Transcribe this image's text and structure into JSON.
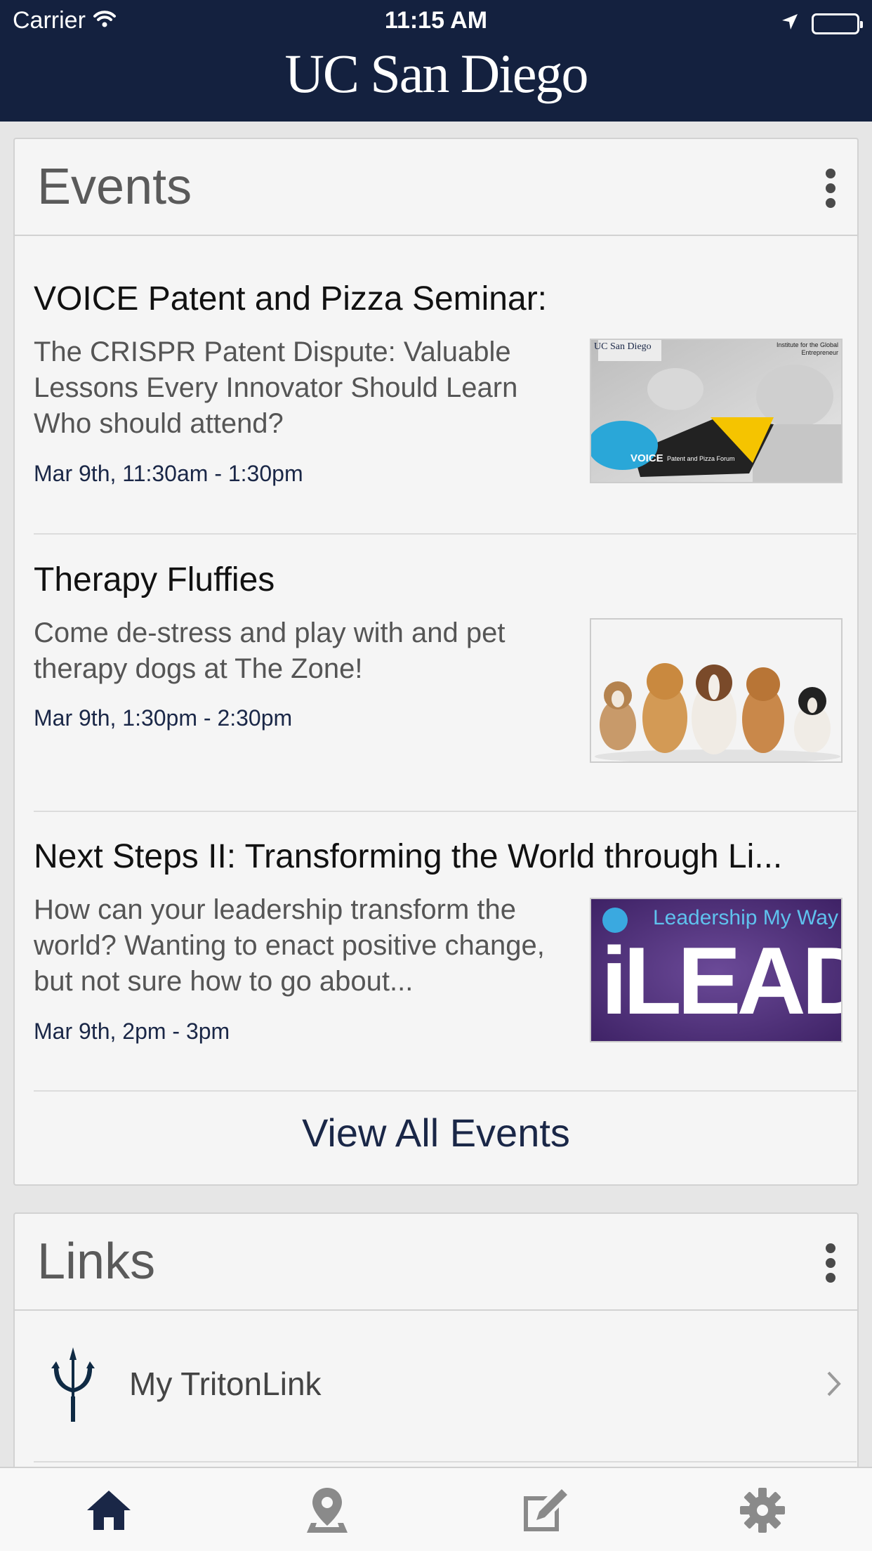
{
  "status_bar": {
    "carrier": "Carrier",
    "time": "11:15 AM"
  },
  "header": {
    "brand": "UC San Diego"
  },
  "events_card": {
    "title": "Events",
    "items": [
      {
        "title": "VOICE Patent and Pizza Seminar:",
        "description": "The CRISPR Patent Dispute: Valuable Lessons Every Innovator Should Learn Who should attend?",
        "date": "Mar 9th, 11:30am - 1:30pm",
        "thumbnail": {
          "brand_text": "UC San Diego",
          "corner_text": "Institute for the Global Entrepreneur",
          "banner_title": "VOICE",
          "banner_subtitle": "Patent and Pizza Forum"
        }
      },
      {
        "title": "Therapy Fluffies",
        "description": "Come de-stress and play with and pet therapy dogs at The Zone!",
        "date": "Mar 9th, 1:30pm - 2:30pm",
        "thumbnail": {
          "icon": "puppies-photo"
        }
      },
      {
        "title": "Next Steps II: Transforming the World through Li...",
        "description": "How can your leadership transform the world? Wanting to enact positive change, but not sure how to go about...",
        "date": "Mar 9th, 2pm - 3pm",
        "thumbnail": {
          "tagline": "Leadership My Way",
          "logo": "iLEAD"
        }
      }
    ],
    "view_all_label": "View All Events"
  },
  "links_card": {
    "title": "Links",
    "items": [
      {
        "label": "My TritonLink",
        "icon": "trident-icon"
      }
    ]
  },
  "tabbar": {
    "tabs": [
      {
        "icon": "home-icon",
        "active": true
      },
      {
        "icon": "map-pin-icon",
        "active": false
      },
      {
        "icon": "edit-icon",
        "active": false
      },
      {
        "icon": "gear-icon",
        "active": false
      }
    ]
  },
  "colors": {
    "navy": "#14213f",
    "card_bg": "#f5f5f5",
    "active_tab": "#1a2747",
    "inactive_tab": "#8a8a8a"
  }
}
